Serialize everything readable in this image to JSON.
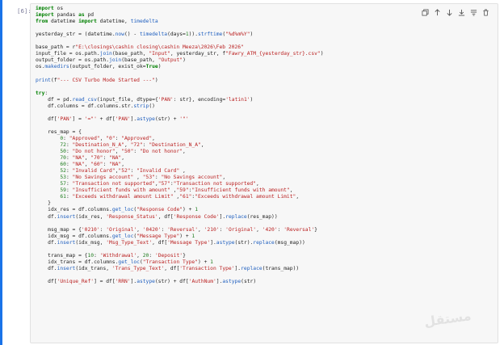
{
  "prompt_label": "[6]:",
  "toolbar": {
    "icons": [
      "copy-icon",
      "move-up-icon",
      "move-down-icon",
      "download-icon",
      "format-icon",
      "delete-icon"
    ]
  },
  "code": {
    "lines": [
      "import os",
      "import pandas as pd",
      "from datetime import datetime, timedelta",
      "",
      "yesterday_str = (datetime.now() - timedelta(days=1)).strftime(\"%d%m%Y\")",
      "",
      "base_path = r\"E:\\closings\\cashin closing\\cashin Meeza\\2026\\Feb 2026\"",
      "input_file = os.path.join(base_path, \"Input\", yesterday_str, f\"Fawry_ATM_{yesterday_str}.csv\")",
      "output_folder = os.path.join(base_path, \"Output\")",
      "os.makedirs(output_folder, exist_ok=True)",
      "",
      "print(f\"--- CSV Turbo Mode Started ---\")",
      "",
      "try:",
      "    df = pd.read_csv(input_file, dtype={'PAN': str}, encoding='latin1')",
      "    df.columns = df.columns.str.strip()",
      "",
      "    df['PAN'] = '=\"' + df['PAN'].astype(str) + '\"'",
      "",
      "    res_map = {",
      "        0: \"Approved\", \"0\": \"Approved\",",
      "        72: \"Destination_N_A\", \"72\": \"Destination_N_A\",",
      "        50: \"Do not honor\", \"50\": \"Do not honor\",",
      "        70: \"NA\", \"70\": \"NA\",",
      "        60: \"NA\", \"60\": \"NA\",",
      "        52: \"Invalid Card\",\"52\": \"Invalid Card\" ,",
      "        53: \"No Savings account\" , \"53\": \"No Savings account\",",
      "        57: \"Transaction not supported\",\"57\":\"Transaction not supported\",",
      "        59: \"Insufficient funds with amount\" ,\"59\":\"Insufficient funds with amount\",",
      "        61: \"Exceeds withdrawal amount Limit\" ,\"61\":\"Exceeds withdrawal amount Limit\",",
      "    }",
      "    idx_res = df.columns.get_loc(\"Response Code\") + 1",
      "    df.insert(idx_res, 'Response_Status', df['Response Code'].replace(res_map))",
      "",
      "    msg_map = {'0210': 'Original', '0420': 'Reversal', '210': 'Original', '420': 'Reversal'}",
      "    idx_msg = df.columns.get_loc(\"Message Type\") + 1",
      "    df.insert(idx_msg, 'Msg_Type_Text', df['Message Type'].astype(str).replace(msg_map))",
      "",
      "    trans_map = {10: 'Withdrawal', 20: 'Deposit'}",
      "    idx_trans = df.columns.get_loc(\"Transaction Type\") + 1",
      "    df.insert(idx_trans, 'Trans_Type_Text', df['Transaction Type'].replace(trans_map))",
      "",
      "    df['Unique_Ref'] = df['RRN'].astype(str) + df['AuthNum'].astype(str)"
    ]
  },
  "watermark_text": "مستقل"
}
